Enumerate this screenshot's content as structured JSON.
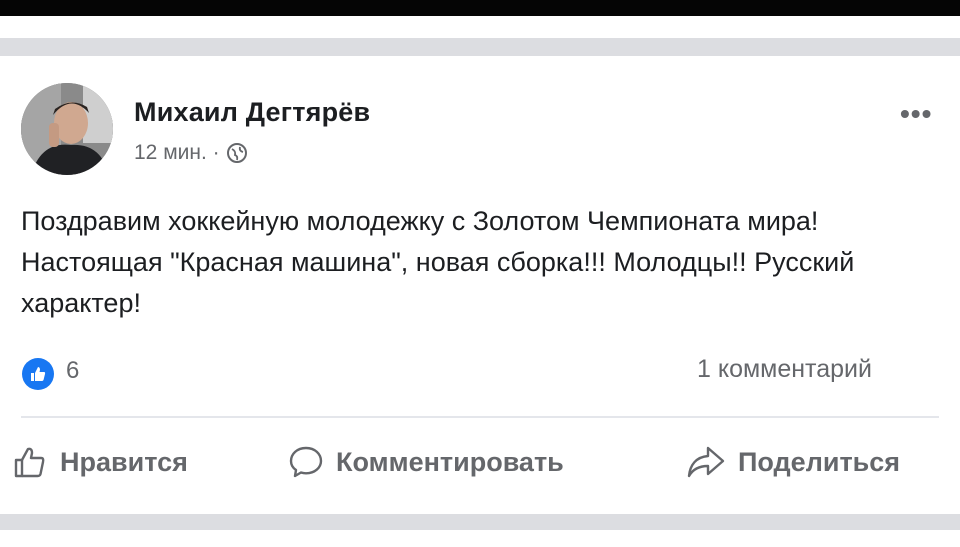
{
  "post": {
    "author": "Михаил Дегтярёв",
    "time": "12 мин. ·",
    "more": "•••",
    "text": "Поздравим хоккейную молодежку с Золотом Чемпионата мира! Настоящая \"Красная машина\", новая сборка!!! Молодцы!! Русский характер!",
    "reactions": {
      "likes": "6",
      "comments": "1 комментарий"
    },
    "actions": {
      "like": "Нравится",
      "comment": "Комментировать",
      "share": "Поделиться"
    }
  },
  "colors": {
    "like_blue": "#1877f2",
    "muted": "#65676b",
    "separator": "#dcdde1"
  },
  "icons": [
    "globe-icon",
    "like-reaction-icon",
    "thumbs-up-icon",
    "comment-icon",
    "share-icon",
    "more-options-icon"
  ]
}
